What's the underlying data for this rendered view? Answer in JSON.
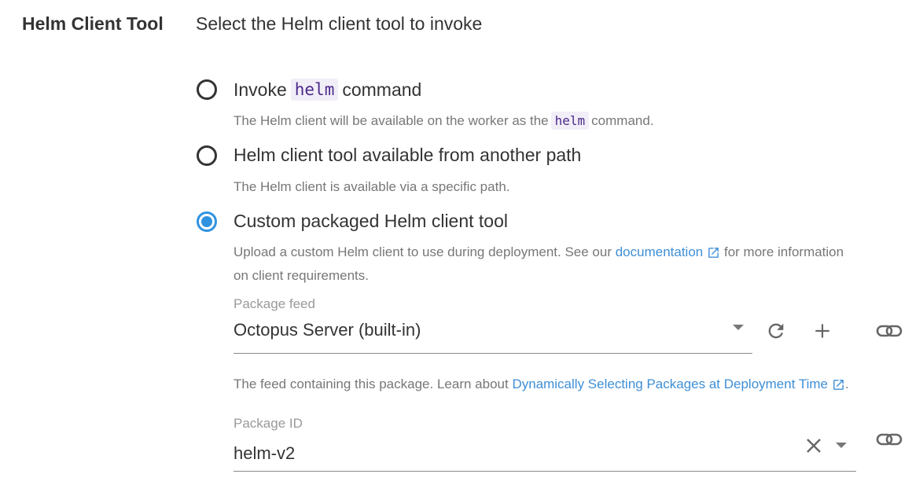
{
  "section": {
    "label": "Helm Client Tool",
    "description": "Select the Helm client tool to invoke"
  },
  "options": [
    {
      "label_before": "Invoke",
      "label_code": "helm",
      "label_after": "command",
      "help_before": "The Helm client will be available on the worker as the",
      "help_code": "helm",
      "help_after": "command.",
      "selected": false
    },
    {
      "label": "Helm client tool available from another path",
      "help": "The Helm client is available via a specific path.",
      "selected": false
    },
    {
      "label": "Custom packaged Helm client tool",
      "help_line1_before": "Upload a custom Helm client to use during deployment. See our",
      "help_link": "documentation",
      "help_line1_after": "for more information",
      "help_line2": "on client requirements.",
      "selected": true
    }
  ],
  "package_feed": {
    "label": "Package feed",
    "value": "Octopus Server (built-in)",
    "help_before": "The feed containing this package. Learn about",
    "help_link": "Dynamically Selecting Packages at Deployment Time",
    "help_after": "."
  },
  "package_id": {
    "label": "Package ID",
    "value": "helm-v2"
  },
  "colors": {
    "accent": "#2f93e0",
    "link": "#3f8fd6",
    "code_bg": "#f2eef8",
    "code_text": "#4b2a8a"
  },
  "icons": {
    "external_link": "external-link-icon",
    "refresh": "refresh-icon",
    "add": "plus-icon",
    "bind": "link-chain-icon",
    "clear": "close-icon",
    "dropdown": "caret-down-icon"
  }
}
